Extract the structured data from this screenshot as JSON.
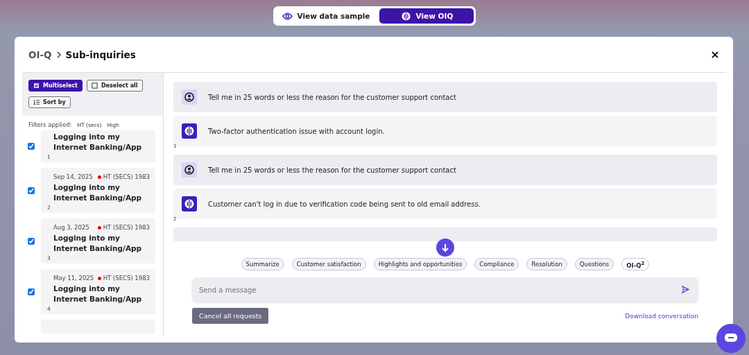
{
  "view_toggle": [
    {
      "label": "View data sample",
      "selected": false
    },
    {
      "label": "View OIQ",
      "selected": true
    }
  ],
  "modal": {
    "breadcrumb": "OI-Q",
    "title": "Sub-inquiries"
  },
  "sidebar": {
    "multiselect": {
      "label": "Multiselect",
      "on": true
    },
    "deselect_all": "Deselect all",
    "sort_by": "Sort by",
    "filters_label": "Filters applied:",
    "filters": [
      "HT (secs)",
      "High"
    ],
    "items": [
      {
        "title": "Logging into my Internet Banking/App",
        "index": "1",
        "checked": true
      },
      {
        "date": "Sep 14, 2025",
        "metric": "HT (SECS) 1983",
        "title": "Logging into my Internet Banking/App",
        "index": "2",
        "checked": true
      },
      {
        "date": "Aug 3, 2025",
        "metric": "HT (SECS) 1983",
        "title": "Logging into my Internet Banking/App",
        "index": "3",
        "checked": true
      },
      {
        "date": "May 11, 2025",
        "metric": "HT (SECS) 1983",
        "title": "Logging into my Internet Banking/App",
        "index": "4",
        "checked": true
      }
    ]
  },
  "conversation": [
    {
      "index": "1",
      "messages": [
        {
          "kind": "user",
          "text": "Tell me in 25 words or less the reason for the customer support contact"
        },
        {
          "kind": "bot",
          "text": "Two-factor authentication issue with account login."
        }
      ]
    },
    {
      "index": "2",
      "messages": [
        {
          "kind": "user",
          "text": "Tell me in 25 words or less the reason for the customer support contact"
        },
        {
          "kind": "bot",
          "text": "Customer can't log in due to verification code being sent to old email address."
        }
      ]
    }
  ],
  "chips": [
    {
      "label": "Summarize",
      "selected": false
    },
    {
      "label": "Customer satisfaction",
      "selected": false
    },
    {
      "label": "Highlights and opportunities",
      "selected": false
    },
    {
      "label": "Compliance",
      "selected": false
    },
    {
      "label": "Resolution",
      "selected": false
    },
    {
      "label": "Questions",
      "selected": false
    },
    {
      "label": "OI-Q$^{2}$",
      "selected": true
    }
  ],
  "composer": {
    "placeholder": "Send a message"
  },
  "cancel_button": "Cancel all requests",
  "download_link": "Download conversation"
}
